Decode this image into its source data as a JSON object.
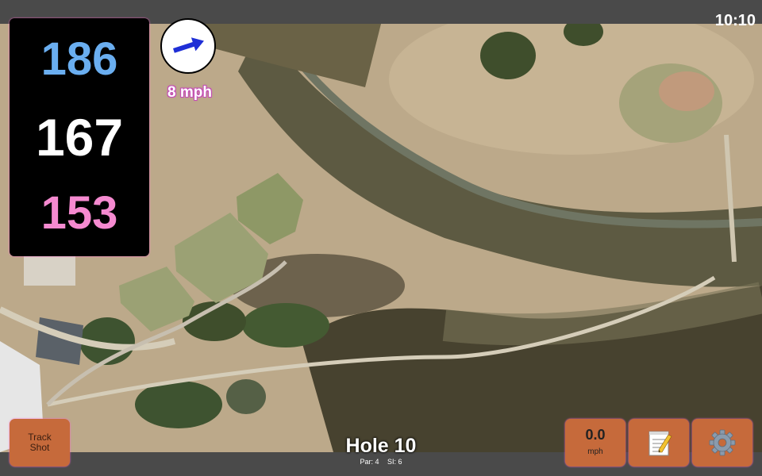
{
  "status": {
    "time": "10:10"
  },
  "distances": {
    "back": "186",
    "middle": "167",
    "front": "153"
  },
  "wind": {
    "speed_label": "8 mph",
    "arrow_color": "#1f2fd6"
  },
  "buttons": {
    "track_shot": {
      "line1": "Track",
      "line2": "Shot"
    },
    "speed": {
      "value": "0.0",
      "unit": "mph"
    },
    "notes_icon": "notepad-icon",
    "settings_icon": "gear-icon"
  },
  "hole": {
    "title": "Hole 10",
    "par": "Par: 4",
    "si": "SI: 6"
  },
  "colors": {
    "button": "#c66a3b",
    "back": "#6aaef0",
    "front": "#f58ad0",
    "wind_text_outline": "#c54bb6"
  }
}
